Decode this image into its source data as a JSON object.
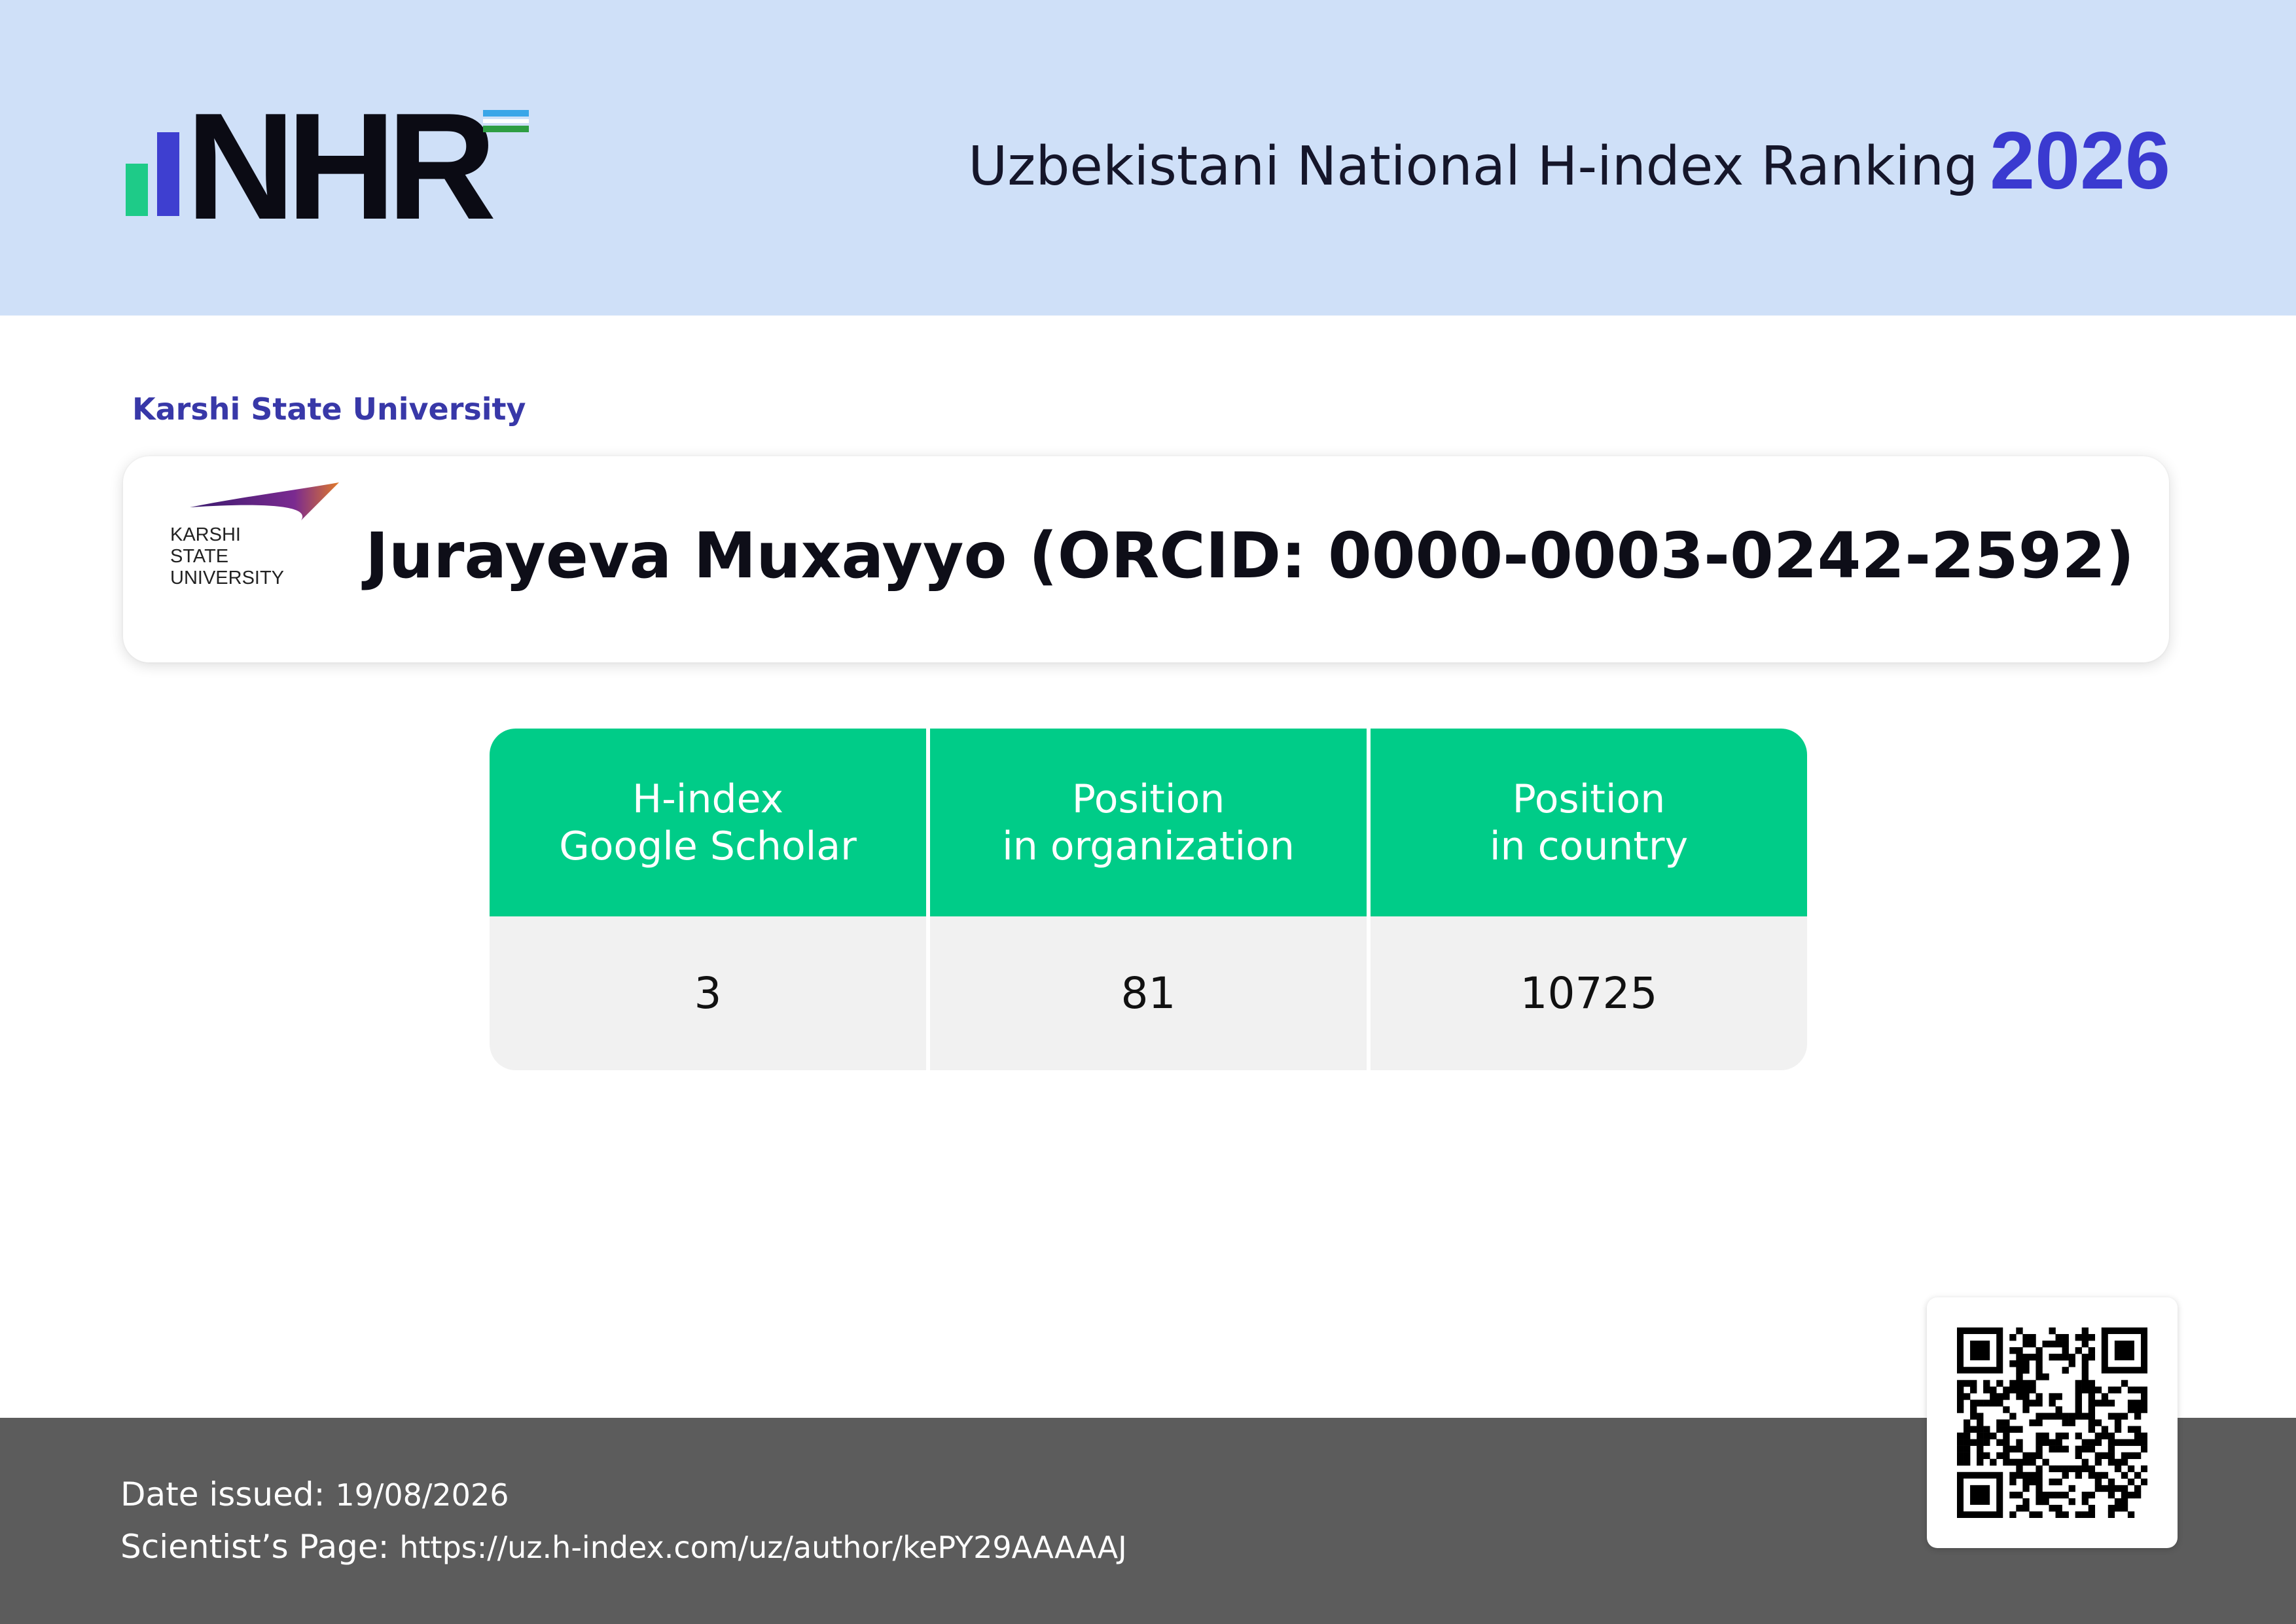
{
  "header": {
    "logo_text": "NHR",
    "title": "Uzbekistani National H-index Ranking",
    "year": "2026",
    "colors": {
      "background": "#cfe0f8",
      "year": "#3a3ad0",
      "logo_bar_green": "#1ecb88",
      "logo_bar_blue": "#3e3fd0"
    }
  },
  "organization": {
    "label": "Karshi State University",
    "logo_lines": [
      "KARSHI",
      "STATE",
      "UNIVERSITY"
    ]
  },
  "scientist": {
    "name": "Jurayeva Muxayyo (ORCID: 0000-0003-0242-2592)"
  },
  "stats": {
    "headers": [
      [
        "H-index",
        "Google Scholar"
      ],
      [
        "Position",
        "in organization"
      ],
      [
        "Position",
        "in country"
      ]
    ],
    "values": [
      "3",
      "81",
      "10725"
    ],
    "colors": {
      "header": "#00cc88",
      "cell": "#f1f1f1"
    }
  },
  "footer": {
    "date_label": "Date issued:",
    "date_value": "19/08/2026",
    "page_label": "Scientist’s Page:",
    "page_value": "https://uz.h-index.com/uz/author/kePY29AAAAAJ",
    "colors": {
      "background": "#5c5c5c"
    }
  },
  "qr": {
    "icon": "qr-code-icon"
  }
}
